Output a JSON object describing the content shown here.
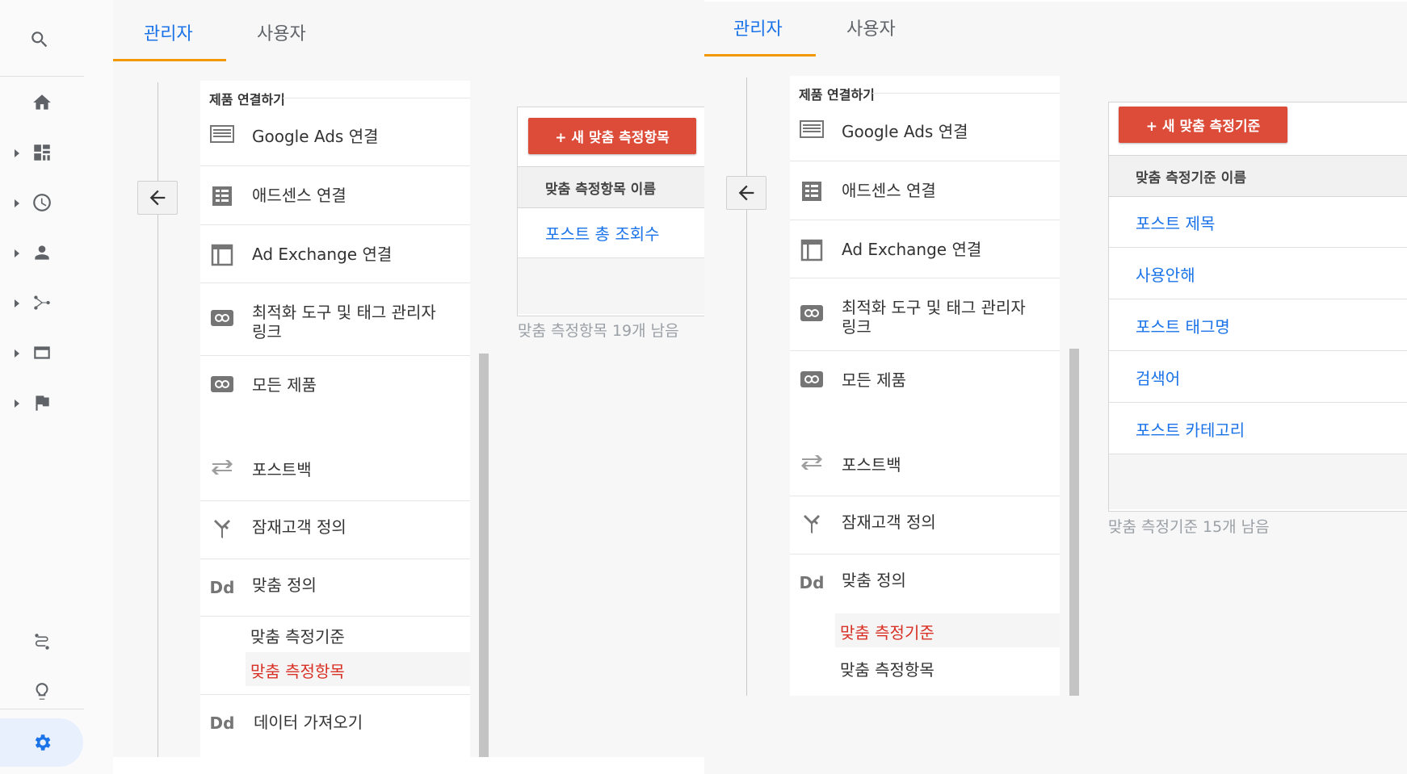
{
  "rail": {
    "icons": [
      "search-icon",
      "home-icon",
      "dashboard-icon",
      "clock-icon",
      "person-icon",
      "fork-icon",
      "window-icon",
      "flag-icon",
      "route-icon",
      "lightbulb-icon",
      "gear-icon"
    ]
  },
  "panels": [
    {
      "tabs": {
        "admin": "관리자",
        "user": "사용자"
      },
      "section_title": "제품 연결하기",
      "nav": [
        {
          "label": "Google Ads 연결",
          "icon": "ads-icon"
        },
        {
          "label": "애드센스 연결",
          "icon": "adsense-icon"
        },
        {
          "label": "Ad Exchange 연결",
          "icon": "ad-exchange-icon"
        },
        {
          "label": "최적화 도구 및 태그 관리자 링크",
          "icon": "link-icon"
        },
        {
          "label": "모든 제품",
          "icon": "link-icon"
        },
        {
          "label": "포스트백",
          "icon": "postback-icon"
        },
        {
          "label": "잠재고객 정의",
          "icon": "audience-icon"
        },
        {
          "label": "맞춤 정의",
          "icon": "dd-icon",
          "icon_text": "Dd"
        }
      ],
      "sub": [
        "맞춤 측정기준",
        "맞춤 측정항목"
      ],
      "last_nav": {
        "label": "데이터 가져오기",
        "icon_text": "Dd"
      },
      "button": "+ 새 맞춤 측정항목",
      "table_header": "맞춤 측정항목 이름",
      "rows": [
        "포스트 총 조회수"
      ],
      "remaining": "맞춤 측정항목 19개 남음"
    },
    {
      "tabs": {
        "admin": "관리자",
        "user": "사용자"
      },
      "section_title": "제품 연결하기",
      "nav": [
        {
          "label": "Google Ads 연결",
          "icon": "ads-icon"
        },
        {
          "label": "애드센스 연결",
          "icon": "adsense-icon"
        },
        {
          "label": "Ad Exchange 연결",
          "icon": "ad-exchange-icon"
        },
        {
          "label": "최적화 도구 및 태그 관리자 링크",
          "icon": "link-icon"
        },
        {
          "label": "모든 제품",
          "icon": "link-icon"
        },
        {
          "label": "포스트백",
          "icon": "postback-icon"
        },
        {
          "label": "잠재고객 정의",
          "icon": "audience-icon"
        },
        {
          "label": "맞춤 정의",
          "icon": "dd-icon",
          "icon_text": "Dd"
        }
      ],
      "sub": [
        "맞춤 측정기준",
        "맞춤 측정항목"
      ],
      "button": "+ 새 맞춤 측정기준",
      "table_header": "맞춤 측정기준 이름",
      "rows": [
        "포스트 제목",
        "사용안해",
        "포스트 태그명",
        "검색어",
        "포스트 카테고리"
      ],
      "remaining": "맞춤 측정기준 15개 남음"
    }
  ],
  "colors": {
    "accent": "#1a73e8",
    "active_tab_underline": "#f29900",
    "button_red": "#dd4b39",
    "active_sub": "#d93025"
  }
}
